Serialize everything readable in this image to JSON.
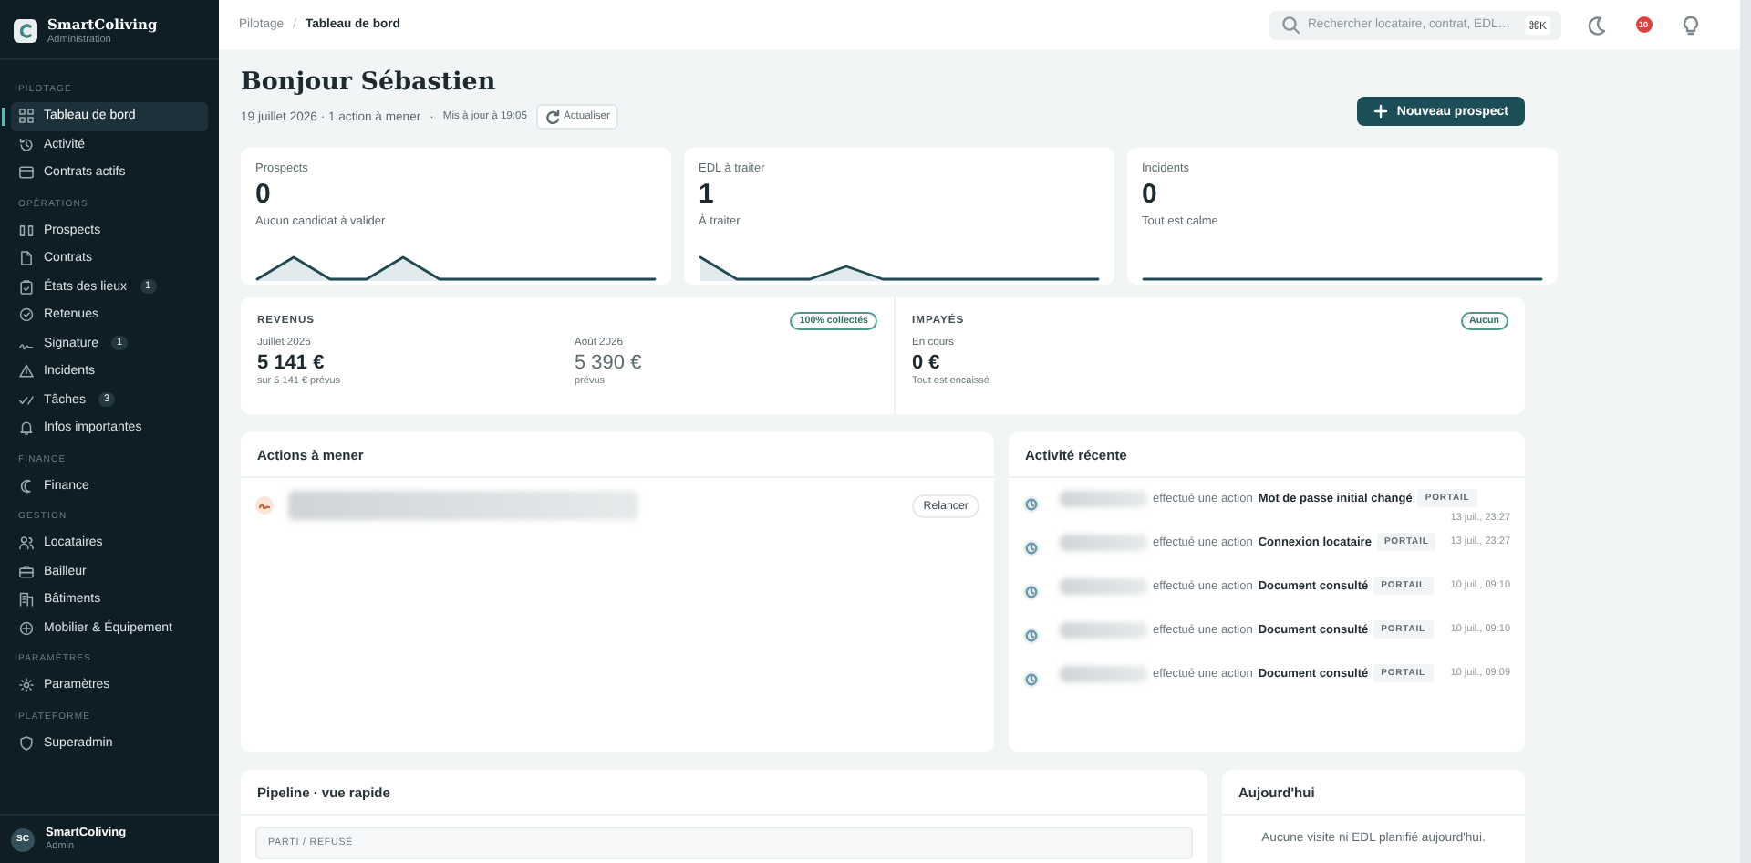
{
  "brand": {
    "name": "SmartColiving",
    "subtitle": "Administration"
  },
  "sidebar": {
    "sections": [
      {
        "label": "PILOTAGE",
        "items": [
          {
            "label": "Tableau de bord",
            "selected": true
          },
          {
            "label": "Activité",
            "selected": false
          },
          {
            "label": "Contrats actifs",
            "selected": false
          }
        ]
      },
      {
        "label": "OPÉRATIONS",
        "items": [
          {
            "label": "Prospects",
            "selected": false
          },
          {
            "label": "Contrats",
            "selected": false
          },
          {
            "label": "États des lieux",
            "badge": "1",
            "selected": false
          },
          {
            "label": "Retenues",
            "selected": false
          },
          {
            "label": "Signature",
            "badge": "1",
            "selected": false
          },
          {
            "label": "Incidents",
            "selected": false
          },
          {
            "label": "Tâches",
            "badge": "3",
            "selected": false
          },
          {
            "label": "Infos importantes",
            "selected": false
          }
        ]
      },
      {
        "label": "FINANCE",
        "items": [
          {
            "label": "Finance",
            "selected": false
          }
        ]
      },
      {
        "label": "GESTION",
        "items": [
          {
            "label": "Locataires",
            "selected": false
          },
          {
            "label": "Bailleur",
            "selected": false
          },
          {
            "label": "Bâtiments",
            "selected": false
          },
          {
            "label": "Mobilier & Équipement",
            "selected": false
          }
        ]
      },
      {
        "label": "PARAMÈTRES",
        "items": [
          {
            "label": "Paramètres",
            "selected": false
          }
        ]
      },
      {
        "label": "PLATEFORME",
        "items": [
          {
            "label": "Superadmin",
            "selected": false
          }
        ]
      }
    ],
    "user": {
      "initials": "SC",
      "name": "SmartColiving",
      "role": "Admin"
    }
  },
  "topbar": {
    "breadcrumb": [
      "Pilotage",
      "Tableau de bord"
    ],
    "separator": "/",
    "search": {
      "placeholder": "Rechercher locataire, contrat, EDL…",
      "shortcut": "⌘K"
    },
    "notification_count": "10"
  },
  "header": {
    "title": "Bonjour Sébastien",
    "subtitle": "19 juillet 2026 · 1 action à mener",
    "separator": "·",
    "updated": "Mis à jour à 19:05",
    "refresh": "Actualiser",
    "primary_button": "Nouveau prospect"
  },
  "stats": [
    {
      "label": "Prospects",
      "value": "0",
      "caption": "Aucun candidat à valider"
    },
    {
      "label": "EDL à traiter",
      "value": "1",
      "caption": "À traiter"
    },
    {
      "label": "Incidents",
      "value": "0",
      "caption": "Tout est calme"
    }
  ],
  "revenus": {
    "title": "REVENUS",
    "badge": "100% collectés",
    "columns": [
      {
        "label": "Juillet 2026",
        "value": "5 141 €",
        "caption": "sur 5 141 € prévus",
        "muted": false
      },
      {
        "label": "Août 2026",
        "value": "5 390 €",
        "caption": "prévus",
        "muted": true
      }
    ]
  },
  "impayes": {
    "title": "IMPAYÉS",
    "badge": "Aucun",
    "label": "En cours",
    "value": "0 €",
    "caption": "Tout est encaissé"
  },
  "actions": {
    "title": "Actions à mener",
    "items": [
      {
        "button": "Relancer"
      }
    ]
  },
  "activity": {
    "title": "Activité récente",
    "items": [
      {
        "verb": "effectué une action",
        "action": "Mot de passe initial changé",
        "tag": "PORTAIL",
        "time": "13 juil., 23:27"
      },
      {
        "verb": "effectué une action",
        "action": "Connexion locataire",
        "tag": "PORTAIL",
        "time": "13 juil., 23:27"
      },
      {
        "verb": "effectué une action",
        "action": "Document consulté",
        "tag": "PORTAIL",
        "time": "10 juil., 09:10"
      },
      {
        "verb": "effectué une action",
        "action": "Document consulté",
        "tag": "PORTAIL",
        "time": "10 juil., 09:10"
      },
      {
        "verb": "effectué une action",
        "action": "Document consulté",
        "tag": "PORTAIL",
        "time": "10 juil., 09:09"
      }
    ]
  },
  "pipeline": {
    "title": "Pipeline · vue rapide",
    "columns": [
      "PARTI / REFUSÉ"
    ]
  },
  "today": {
    "title": "Aujourd'hui",
    "empty": "Aucune visite ni EDL planifié aujourd'hui."
  }
}
